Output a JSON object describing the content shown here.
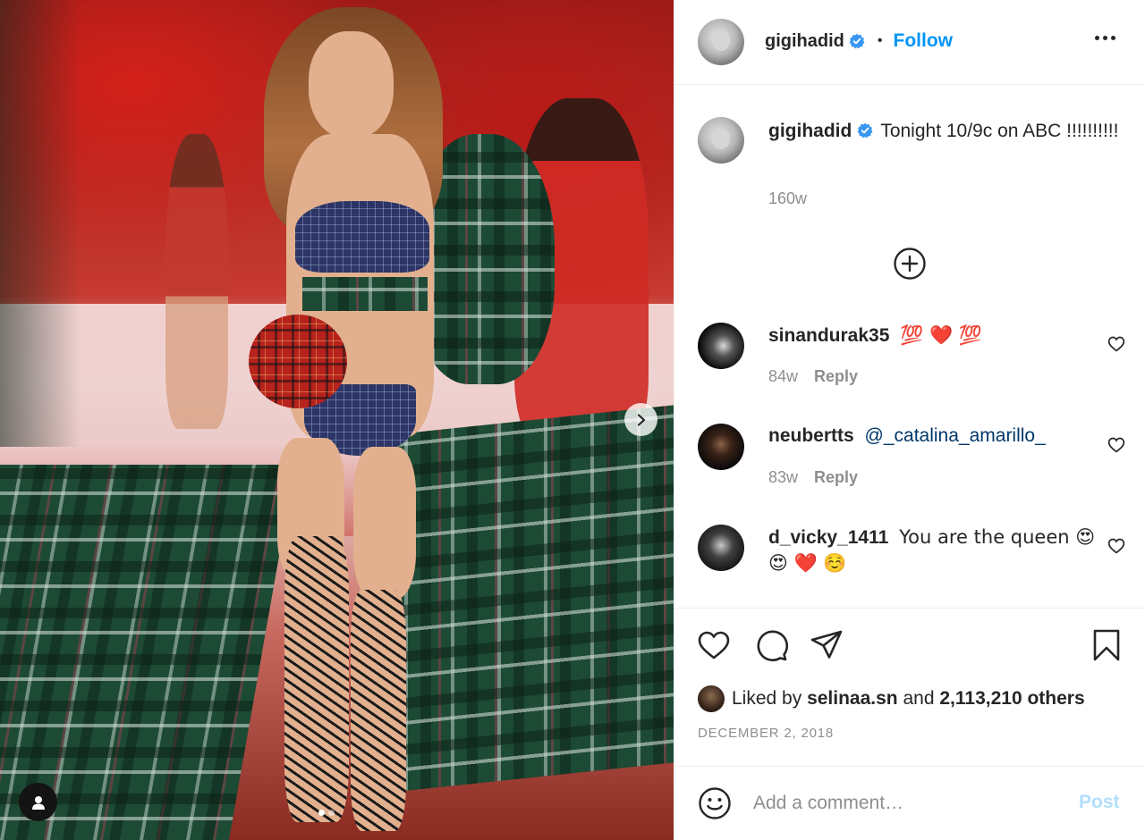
{
  "post": {
    "username": "gigihadid",
    "follow_label": "Follow",
    "separator": "•",
    "caption_text": "Tonight 10/9c on ABC !!!!!!!!!!",
    "caption_time": "160w"
  },
  "comments": [
    {
      "username": "sinandurak35",
      "text": "💯 ❤️ 💯",
      "time": "84w",
      "reply_label": "Reply"
    },
    {
      "username": "neubertts",
      "text": "@_catalina_amarillo_",
      "time": "83w",
      "reply_label": "Reply"
    },
    {
      "username": "d_vicky_1411",
      "text": "You are the queen 😍 😍 ❤️ ☺️",
      "time": "",
      "reply_label": ""
    }
  ],
  "likes": {
    "prefix": "Liked by",
    "user": "selinaa.sn",
    "conjunction": "and",
    "others": "2,113,210 others"
  },
  "date": "DECEMBER 2, 2018",
  "comment_box": {
    "placeholder": "Add a comment…",
    "post_label": "Post"
  },
  "colors": {
    "accent": "#0095f6",
    "verified": "#3897f0",
    "post_disabled": "#b2dffc",
    "muted": "#8e8e8e",
    "heart_red": "#ed4956"
  },
  "icons": {
    "verified": "verified-badge-icon",
    "more": "more-options-icon",
    "add": "plus-circle-icon",
    "heart": "heart-icon",
    "comment": "comment-icon",
    "share": "paper-plane-icon",
    "save": "bookmark-icon",
    "emoji": "smiley-icon",
    "next": "chevron-right-icon",
    "tag": "user-tag-icon"
  },
  "carousel": {
    "count": 2,
    "current": 1
  }
}
